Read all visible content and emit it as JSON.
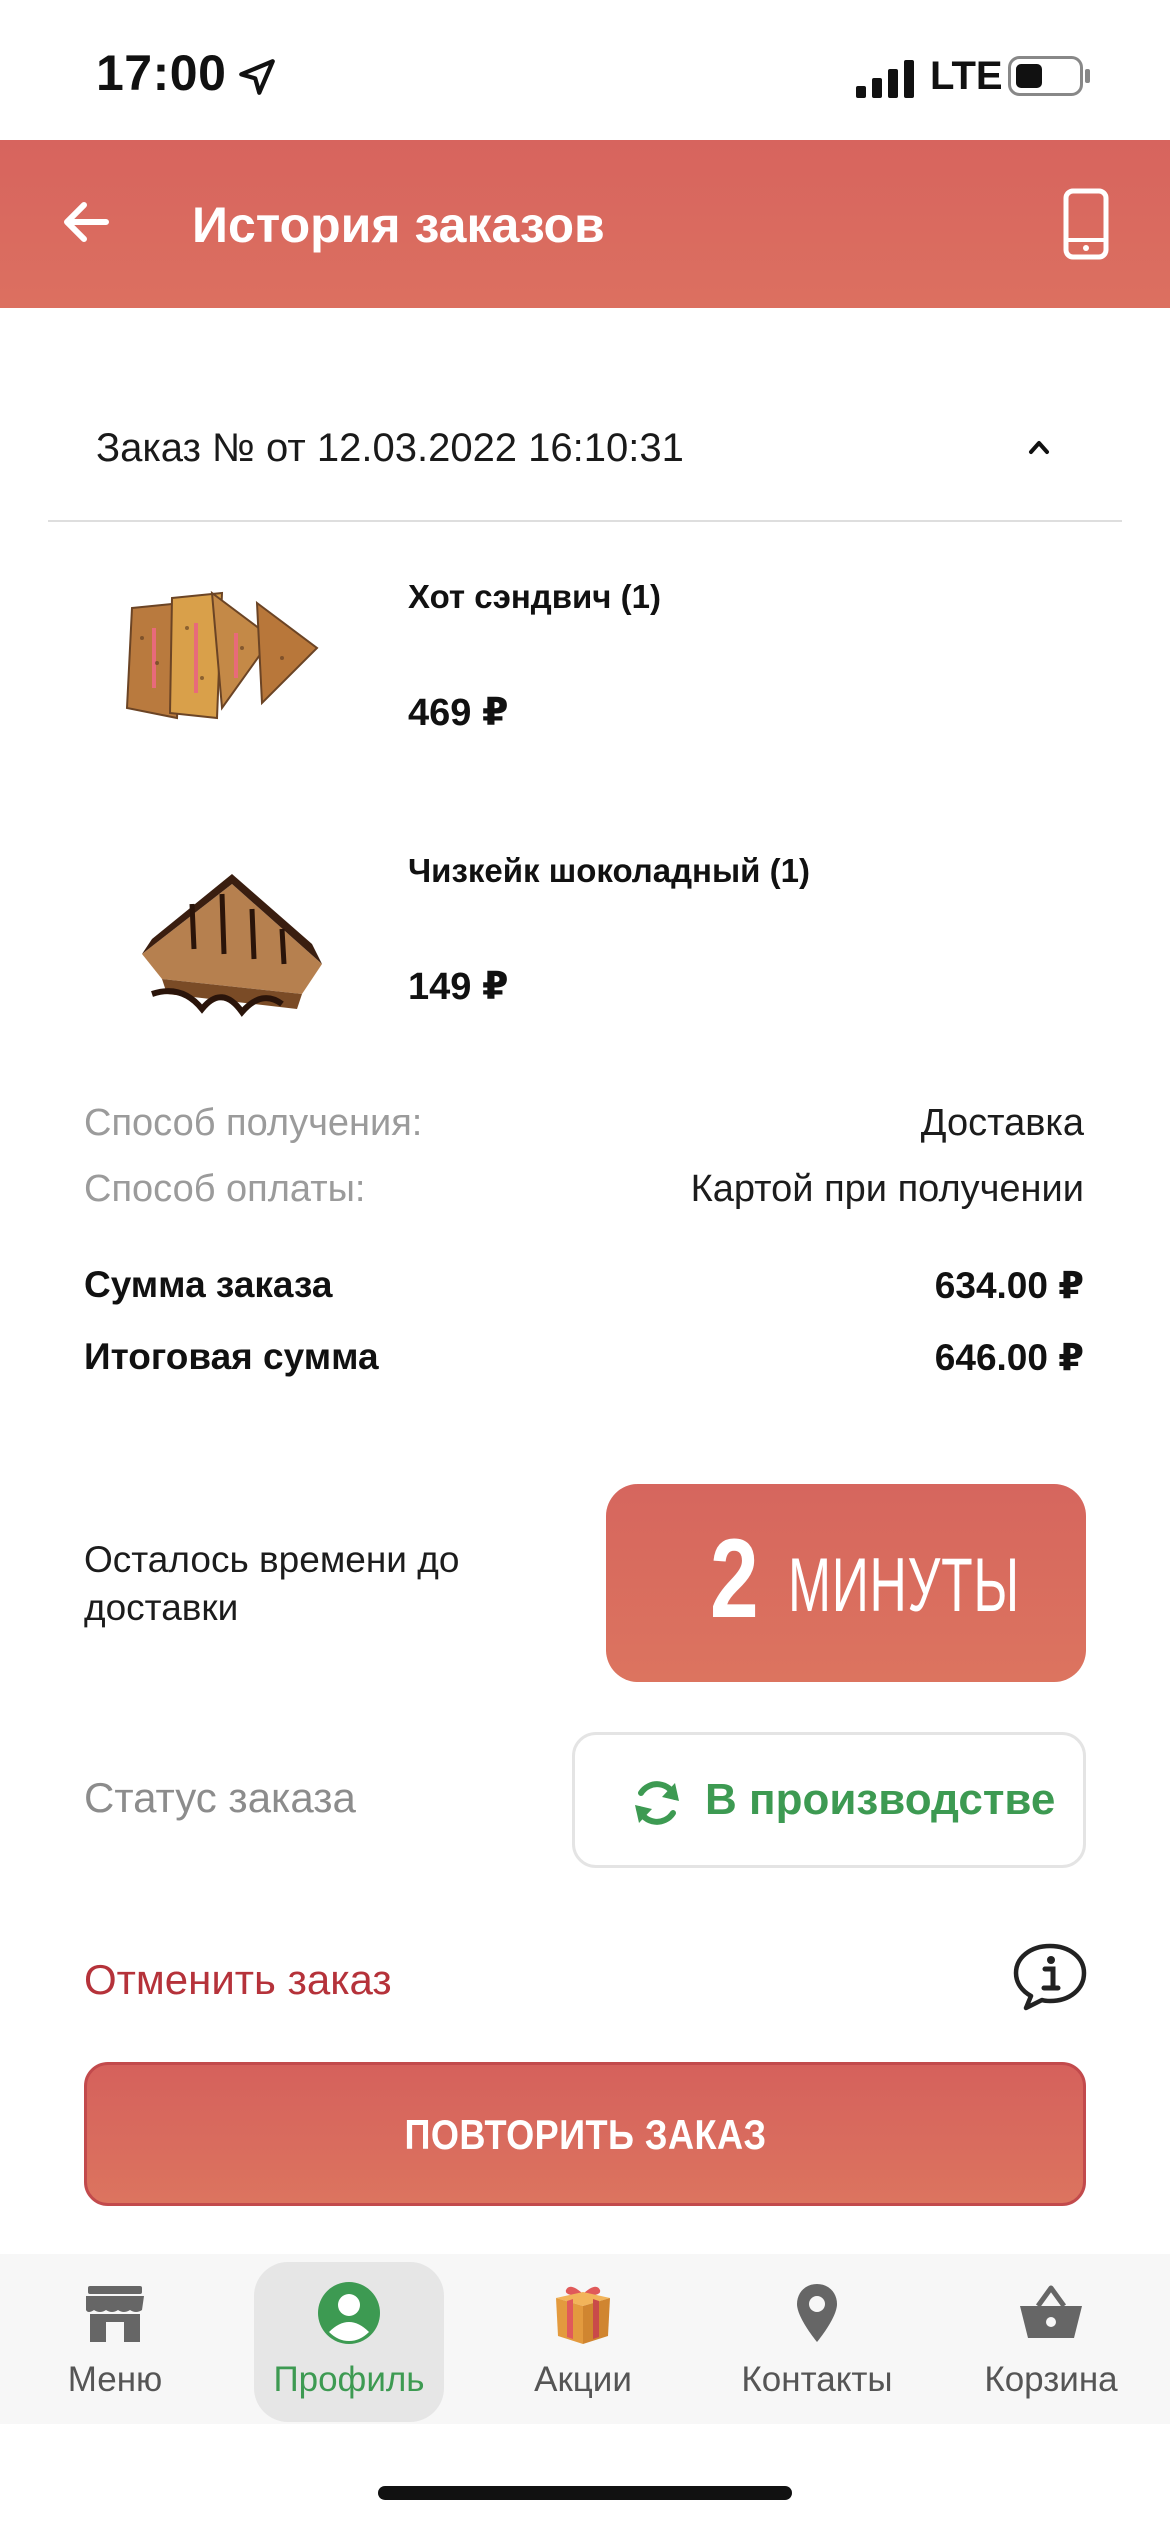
{
  "status_bar": {
    "time": "17:00",
    "network": "LTE"
  },
  "header": {
    "title": "История заказов"
  },
  "order": {
    "title": "Заказ № от 12.03.2022 16:10:31"
  },
  "items": [
    {
      "name": "Хот сэндвич (1)",
      "price": "469 ₽"
    },
    {
      "name": "Чизкейк шоколадный (1)",
      "price": "149 ₽"
    }
  ],
  "summary": {
    "receive_label": "Способ получения:",
    "receive_value": "Доставка",
    "payment_label": "Способ оплаты:",
    "payment_value": "Картой при получении",
    "sum_label": "Сумма заказа",
    "sum_value": "634.00 ₽",
    "total_label": "Итоговая сумма",
    "total_value": "646.00 ₽"
  },
  "delivery": {
    "label": "Осталось времени до доставки",
    "number": "2",
    "unit": "МИНУТЫ"
  },
  "status": {
    "label": "Статус заказа",
    "value": "В производстве",
    "color": "#3d9a52"
  },
  "cancel": {
    "label": "Отменить заказ"
  },
  "repeat_button": {
    "label": "ПОВТОРИТЬ ЗАКАЗ"
  },
  "tabs": [
    {
      "label": "Меню",
      "icon": "store-icon"
    },
    {
      "label": "Профиль",
      "icon": "profile-icon",
      "active": true
    },
    {
      "label": "Акции",
      "icon": "gift-icon"
    },
    {
      "label": "Контакты",
      "icon": "location-pin-icon"
    },
    {
      "label": "Корзина",
      "icon": "basket-icon"
    }
  ],
  "colors": {
    "accent": "#d7645e",
    "green": "#3d9a52",
    "cancel": "#b5323a"
  }
}
